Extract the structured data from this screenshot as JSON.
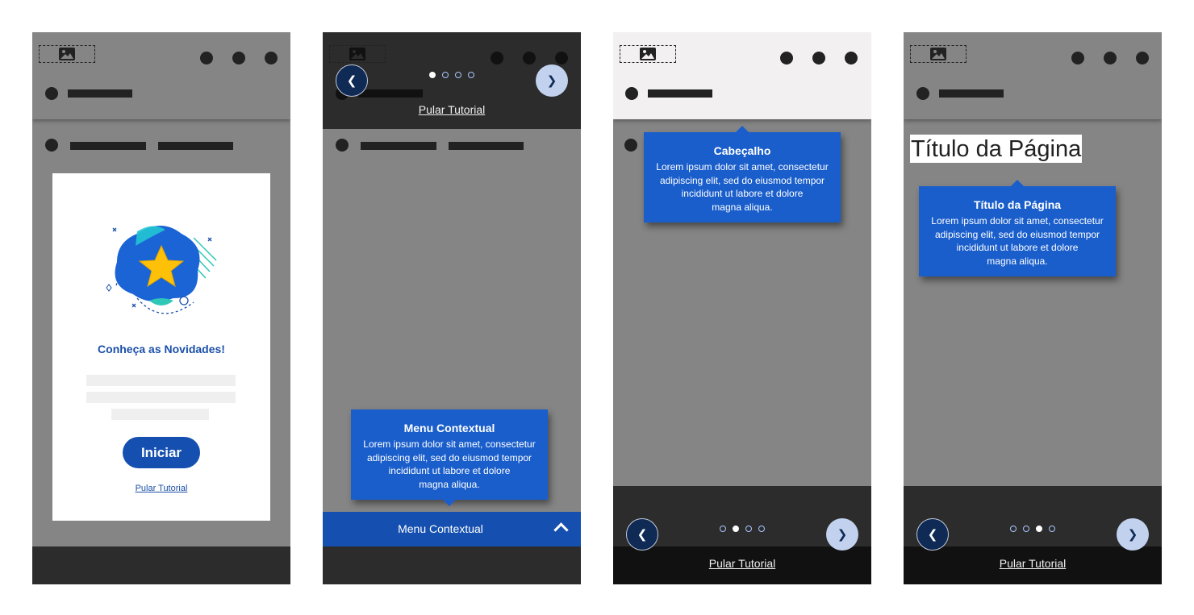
{
  "colors": {
    "accent": "#1a5ecb",
    "accent_dark": "#1550b0",
    "overlay": "#858585",
    "dark": "#2c2c2c"
  },
  "icons": {
    "logo": "image-icon",
    "prev": "chevron-left-icon",
    "next": "chevron-right-icon",
    "menu": "chevron-up-icon",
    "illustration": "star-icon"
  },
  "screen1": {
    "card_title": "Conheça as Novidades!",
    "start_button": "Iniciar",
    "skip_link": "Pular Tutorial"
  },
  "screen2": {
    "skip_link": "Pular Tutorial",
    "active_step": 1,
    "tooltip": {
      "title": "Menu Contextual",
      "body": "Lorem ipsum dolor sit amet, consectetur\nadipiscing elit, sed do eiusmod tempor\nincididunt ut labore et dolore\nmagna aliqua."
    },
    "menu_bar_label": "Menu Contextual"
  },
  "screen3": {
    "skip_link": "Pular Tutorial",
    "active_step": 2,
    "tooltip": {
      "title": "Cabeçalho",
      "body": "Lorem ipsum dolor sit amet, consectetur\nadipiscing elit, sed do eiusmod tempor\nincididunt ut labore et dolore\nmagna aliqua."
    }
  },
  "screen4": {
    "skip_link": "Pular Tutorial",
    "active_step": 3,
    "page_title": "Título da Página",
    "tooltip": {
      "title": "Título da Página",
      "body": "Lorem ipsum dolor sit amet, consectetur\nadipiscing elit, sed do eiusmod tempor\nincididunt ut labore et dolore\nmagna aliqua."
    }
  }
}
